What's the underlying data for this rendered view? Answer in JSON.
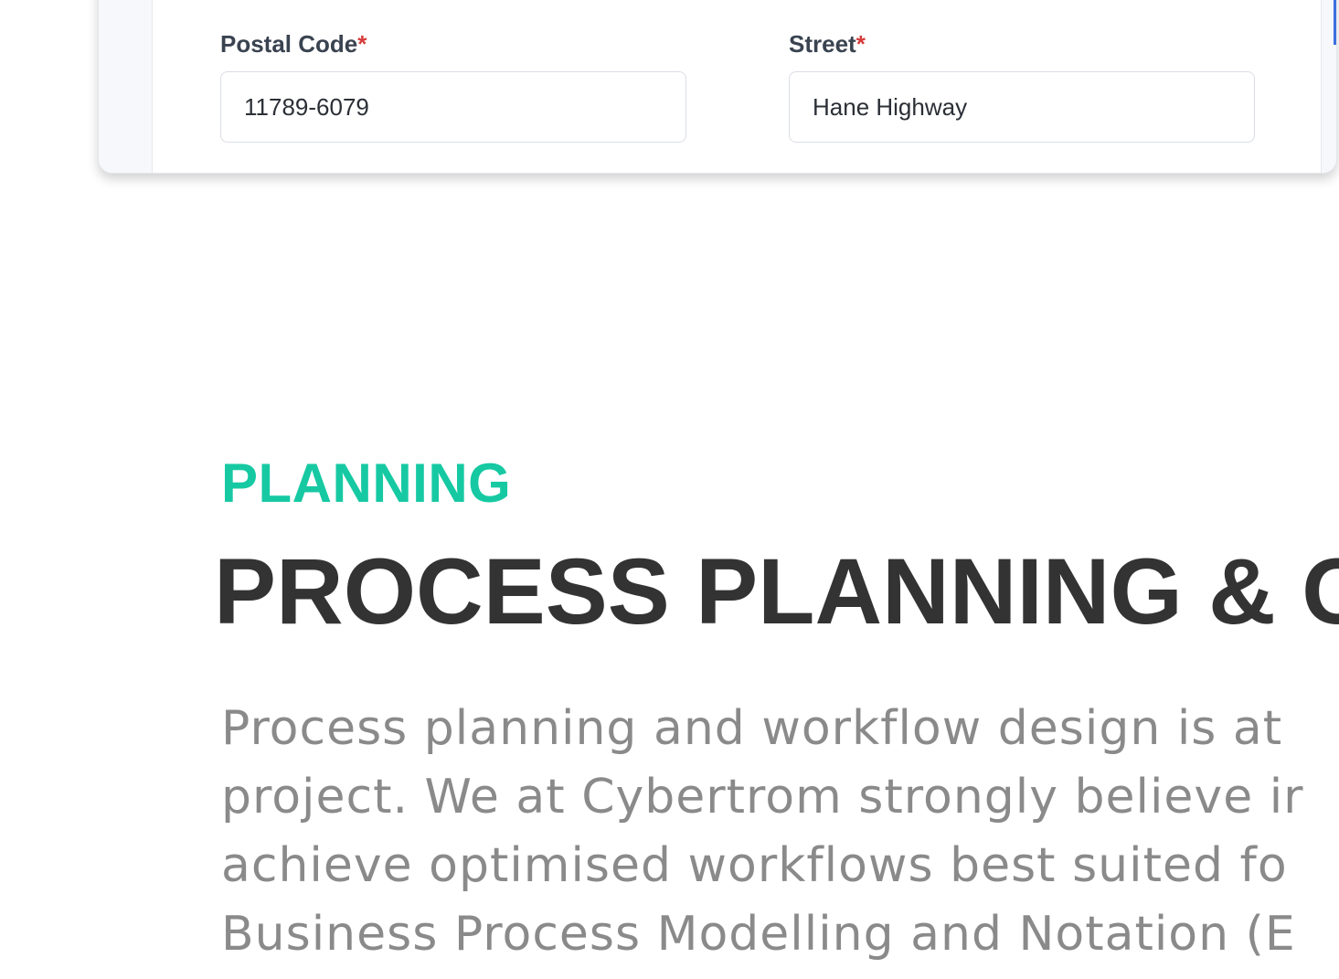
{
  "form": {
    "postal_code": {
      "label": "Postal Code",
      "required_mark": "*",
      "value": "11789-6079"
    },
    "street": {
      "label": "Street",
      "required_mark": "*",
      "value": "Hane Highway"
    }
  },
  "section": {
    "eyebrow": "PLANNING",
    "headline": "PROCESS PLANNING & OI",
    "body_lines": [
      "Process planning and workflow design is at",
      "project. We at Cybertrom strongly believe ir",
      "achieve optimised workflows best suited fo",
      "Business Process Modelling and Notation (E"
    ]
  },
  "colors": {
    "accent_green": "#16c9a3",
    "required_red": "#d63a3a",
    "headline": "#333333",
    "body_text": "#8a8a8a",
    "accent_blue": "#3b6fe0"
  }
}
